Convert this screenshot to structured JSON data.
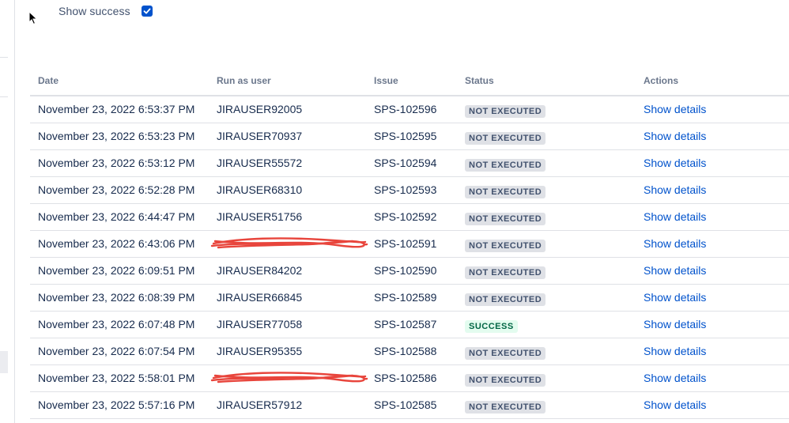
{
  "filter": {
    "show_success_label": "Show success",
    "show_success_checked": true
  },
  "table": {
    "headers": {
      "date": "Date",
      "run_as_user": "Run as user",
      "issue": "Issue",
      "status": "Status",
      "actions": "Actions"
    },
    "rows": [
      {
        "date": "November 23, 2022 6:53:37 PM",
        "user": "JIRAUSER92005",
        "issue": "SPS-102596",
        "status": "NOT EXECUTED",
        "action": "Show details"
      },
      {
        "date": "November 23, 2022 6:53:23 PM",
        "user": "JIRAUSER70937",
        "issue": "SPS-102595",
        "status": "NOT EXECUTED",
        "action": "Show details"
      },
      {
        "date": "November 23, 2022 6:53:12 PM",
        "user": "JIRAUSER55572",
        "issue": "SPS-102594",
        "status": "NOT EXECUTED",
        "action": "Show details"
      },
      {
        "date": "November 23, 2022 6:52:28 PM",
        "user": "JIRAUSER68310",
        "issue": "SPS-102593",
        "status": "NOT EXECUTED",
        "action": "Show details"
      },
      {
        "date": "November 23, 2022 6:44:47 PM",
        "user": "JIRAUSER51756",
        "issue": "SPS-102592",
        "status": "NOT EXECUTED",
        "action": "Show details"
      },
      {
        "date": "November 23, 2022 6:43:06 PM",
        "user": "",
        "issue": "SPS-102591",
        "status": "NOT EXECUTED",
        "action": "Show details",
        "redacted": true
      },
      {
        "date": "November 23, 2022 6:09:51 PM",
        "user": "JIRAUSER84202",
        "issue": "SPS-102590",
        "status": "NOT EXECUTED",
        "action": "Show details"
      },
      {
        "date": "November 23, 2022 6:08:39 PM",
        "user": "JIRAUSER66845",
        "issue": "SPS-102589",
        "status": "NOT EXECUTED",
        "action": "Show details"
      },
      {
        "date": "November 23, 2022 6:07:48 PM",
        "user": "JIRAUSER77058",
        "issue": "SPS-102587",
        "status": "SUCCESS",
        "action": "Show details"
      },
      {
        "date": "November 23, 2022 6:07:54 PM",
        "user": "JIRAUSER95355",
        "issue": "SPS-102588",
        "status": "NOT EXECUTED",
        "action": "Show details"
      },
      {
        "date": "November 23, 2022 5:58:01 PM",
        "user": "",
        "issue": "SPS-102586",
        "status": "NOT EXECUTED",
        "action": "Show details",
        "redacted": true
      },
      {
        "date": "November 23, 2022 5:57:16 PM",
        "user": "JIRAUSER57912",
        "issue": "SPS-102585",
        "status": "NOT EXECUTED",
        "action": "Show details"
      }
    ]
  },
  "icons": {
    "cursor": "mouse-pointer-icon",
    "checkbox": "checkmark-icon"
  },
  "colors": {
    "link": "#0052cc",
    "not_executed_bg": "#dfe1e6",
    "success_bg": "#e3fcef",
    "success_text": "#006644",
    "redaction": "#e8453c"
  }
}
